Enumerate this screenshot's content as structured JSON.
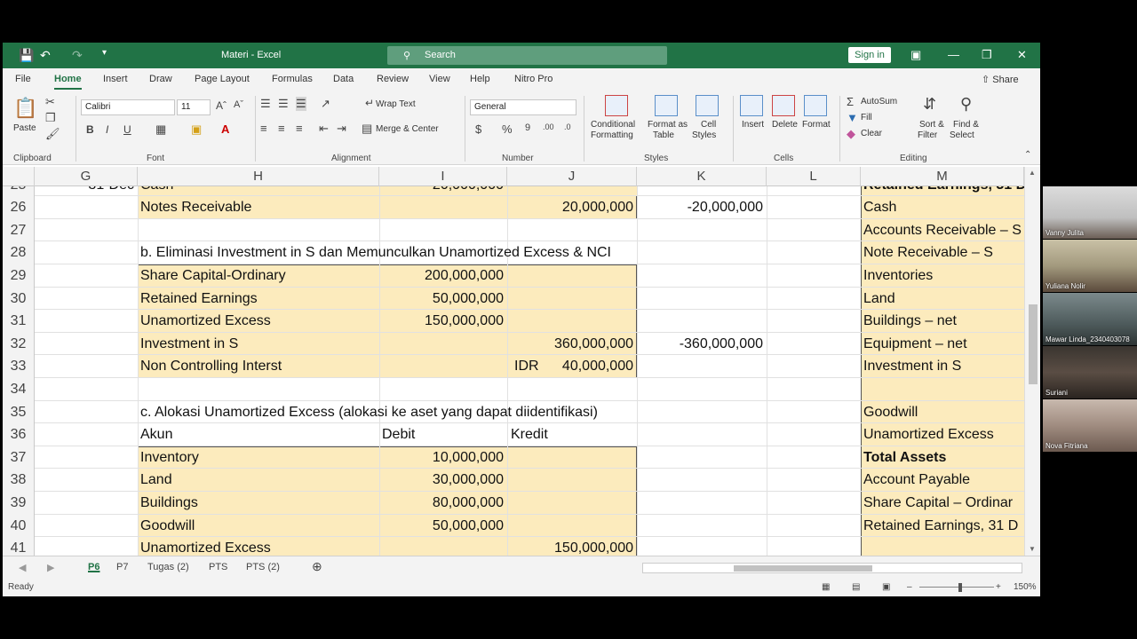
{
  "titlebar": {
    "title": "Materi  -  Excel",
    "search_placeholder": "Search",
    "signin": "Sign in"
  },
  "menu": {
    "tabs": [
      "File",
      "Home",
      "Insert",
      "Draw",
      "Page Layout",
      "Formulas",
      "Data",
      "Review",
      "View",
      "Help",
      "Nitro Pro"
    ],
    "active": "Home",
    "share": "Share"
  },
  "ribbon": {
    "paste": "Paste",
    "font_name": "Calibri",
    "font_size": "11",
    "wrap_text": "Wrap Text",
    "merge_center": "Merge & Center",
    "number_format": "General",
    "conditional_formatting": [
      "Conditional",
      "Formatting"
    ],
    "format_as_table": [
      "Format as",
      "Table"
    ],
    "cell_styles": [
      "Cell",
      "Styles"
    ],
    "insert": "Insert",
    "delete": "Delete",
    "format": "Format",
    "autosum": "AutoSum",
    "fill": "Fill",
    "clear": "Clear",
    "sort_filter": [
      "Sort &",
      "Filter"
    ],
    "find_select": [
      "Find &",
      "Select"
    ],
    "groups": {
      "clipboard": "Clipboard",
      "font": "Font",
      "alignment": "Alignment",
      "number": "Number",
      "styles": "Styles",
      "cells": "Cells",
      "editing": "Editing"
    }
  },
  "columns": [
    "G",
    "H",
    "I",
    "J",
    "K",
    "L",
    "M"
  ],
  "rows": [
    {
      "n": "25",
      "g": "31-Dec",
      "h": "Cash",
      "i": "20,000,000",
      "j": "",
      "k": "",
      "m": "Retained Earnings, 31 D"
    },
    {
      "n": "26",
      "g": "",
      "h": "Notes Receivable",
      "i": "",
      "j": "20,000,000",
      "k": "-20,000,000",
      "m": "Cash"
    },
    {
      "n": "27",
      "g": "",
      "h": "",
      "i": "",
      "j": "",
      "k": "",
      "m": "Accounts Receivable – S"
    },
    {
      "n": "28",
      "g": "",
      "h": "b. Eliminasi Investment in S dan Memunculkan Unamortized Excess & NCI",
      "i": "",
      "j": "",
      "k": "",
      "m": "Note Receivable – S"
    },
    {
      "n": "29",
      "g": "",
      "h": "Share Capital-Ordinary",
      "i": "200,000,000",
      "j": "",
      "k": "",
      "m": "Inventories"
    },
    {
      "n": "30",
      "g": "",
      "h": "Retained Earnings",
      "i": "50,000,000",
      "j": "",
      "k": "",
      "m": "Land"
    },
    {
      "n": "31",
      "g": "",
      "h": "Unamortized Excess",
      "i": "150,000,000",
      "j": "",
      "k": "",
      "m": "Buildings – net"
    },
    {
      "n": "32",
      "g": "",
      "h": "Investment in S",
      "i": "",
      "j": "360,000,000",
      "k": "-360,000,000",
      "m": "Equipment – net"
    },
    {
      "n": "33",
      "g": "",
      "h": "Non Controlling Interst",
      "i": "",
      "j_prefix": "IDR",
      "j": "40,000,000",
      "k": "",
      "m": "Investment in S"
    },
    {
      "n": "34",
      "g": "",
      "h": "",
      "i": "",
      "j": "",
      "k": "",
      "m": ""
    },
    {
      "n": "35",
      "g": "",
      "h": "c. Alokasi Unamortized Excess (alokasi ke aset yang dapat diidentifikasi)",
      "i": "",
      "j": "",
      "k": "",
      "m": "Goodwill"
    },
    {
      "n": "36",
      "g": "",
      "h": "Akun",
      "i": "Debit",
      "j": "Kredit",
      "k": "",
      "m": "Unamortized Excess"
    },
    {
      "n": "37",
      "g": "",
      "h": "Inventory",
      "i": "10,000,000",
      "j": "",
      "k": "",
      "m": "Total Assets"
    },
    {
      "n": "38",
      "g": "",
      "h": "Land",
      "i": "30,000,000",
      "j": "",
      "k": "",
      "m": "Account Payable"
    },
    {
      "n": "39",
      "g": "",
      "h": "Buildings",
      "i": "80,000,000",
      "j": "",
      "k": "",
      "m": "Share Capital – Ordinar"
    },
    {
      "n": "40",
      "g": "",
      "h": "Goodwill",
      "i": "50,000,000",
      "j": "",
      "k": "",
      "m": "Retained Earnings, 31 D"
    },
    {
      "n": "41",
      "g": "",
      "h": "Unamortized Excess",
      "i": "",
      "j": "150,000,000",
      "k": "",
      "m": ""
    }
  ],
  "sheets": [
    "P6",
    "P7",
    "Tugas (2)",
    "PTS",
    "PTS (2)"
  ],
  "active_sheet": "P6",
  "status": {
    "ready": "Ready",
    "zoom": "150%"
  },
  "participants": [
    "Vanny Julita",
    "Yuliana Nolir",
    "Mawar Linda_2340403078",
    "Suriani",
    "Nova Fitriana"
  ]
}
